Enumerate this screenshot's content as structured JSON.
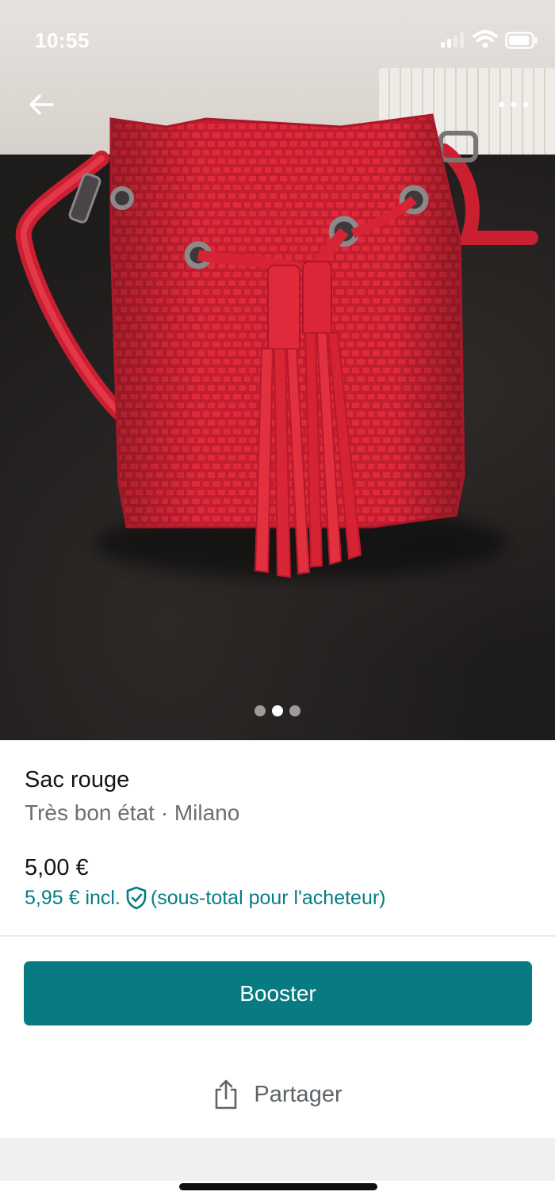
{
  "status_bar": {
    "time": "10:55"
  },
  "icons": {
    "back": "arrow-left-icon",
    "more": "more-horizontal-icon",
    "shield": "shield-check-icon",
    "share": "share-icon",
    "signal": "cellular-signal-icon",
    "wifi": "wifi-icon",
    "battery": "battery-icon"
  },
  "gallery": {
    "image_count": 3,
    "active_index": 1
  },
  "listing": {
    "title": "Sac rouge",
    "condition": "Très bon état",
    "separator": " · ",
    "brand": "Milano",
    "price": "5,00 €",
    "buyer_price": "5,95 € incl.",
    "buyer_note": "(sous-total pour l'acheteur)"
  },
  "actions": {
    "booster_label": "Booster",
    "share_label": "Partager"
  },
  "colors": {
    "accent": "#087a82",
    "accent_text": "#087c84",
    "bag_red": "#e32a3a"
  }
}
